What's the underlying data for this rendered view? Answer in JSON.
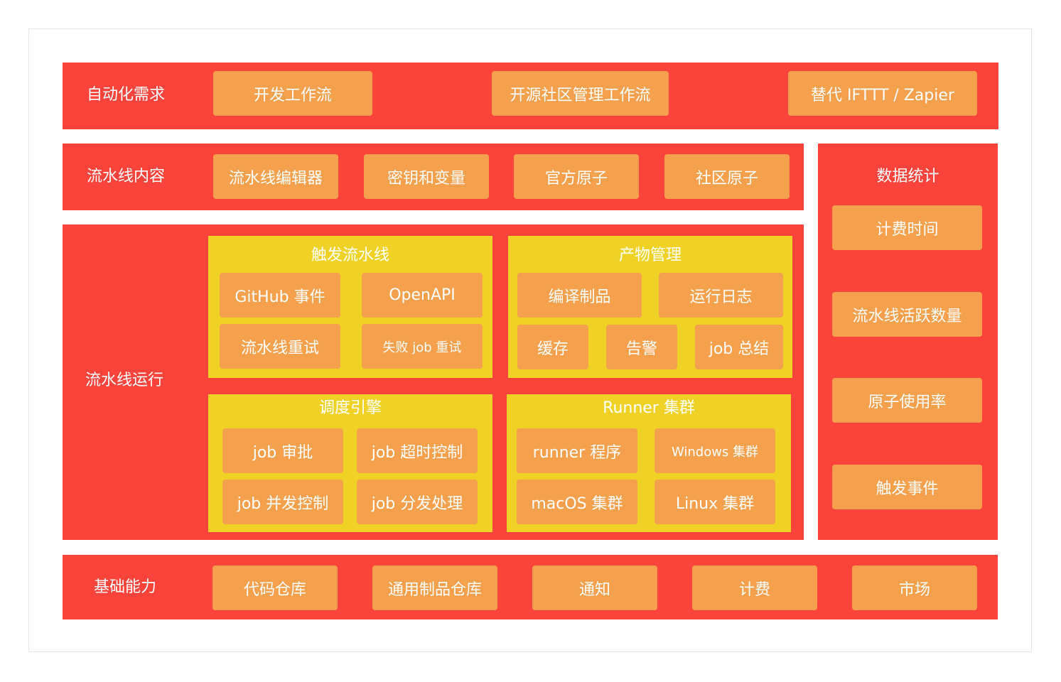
{
  "colors": {
    "band": "#fa443b",
    "box": "#f5a04c",
    "group": "#f0d227",
    "text": "#ffffff"
  },
  "automation": {
    "label": "自动化需求",
    "items": [
      "开发工作流",
      "开源社区管理工作流",
      "替代 IFTTT / Zapier"
    ]
  },
  "content": {
    "label": "流水线内容",
    "items": [
      "流水线编辑器",
      "密钥和变量",
      "官方原子",
      "社区原子"
    ]
  },
  "stats": {
    "label": "数据统计",
    "items": [
      "计费时间",
      "流水线活跃数量",
      "原子使用率",
      "触发事件"
    ]
  },
  "run": {
    "label": "流水线运行",
    "trigger": {
      "title": "触发流水线",
      "items": [
        "GitHub 事件",
        "OpenAPI",
        "流水线重试",
        "失败 job 重试"
      ]
    },
    "artifacts": {
      "title": "产物管理",
      "items": [
        "编译制品",
        "运行日志",
        "缓存",
        "告警",
        "job 总结"
      ]
    },
    "scheduler": {
      "title": "调度引擎",
      "items": [
        "job 审批",
        "job 超时控制",
        "job 并发控制",
        "job 分发处理"
      ]
    },
    "runner": {
      "title": "Runner 集群",
      "items": [
        "runner 程序",
        "Windows 集群",
        "macOS 集群",
        "Linux 集群"
      ]
    }
  },
  "infra": {
    "label": "基础能力",
    "items": [
      "代码仓库",
      "通用制品仓库",
      "通知",
      "计费",
      "市场"
    ]
  }
}
